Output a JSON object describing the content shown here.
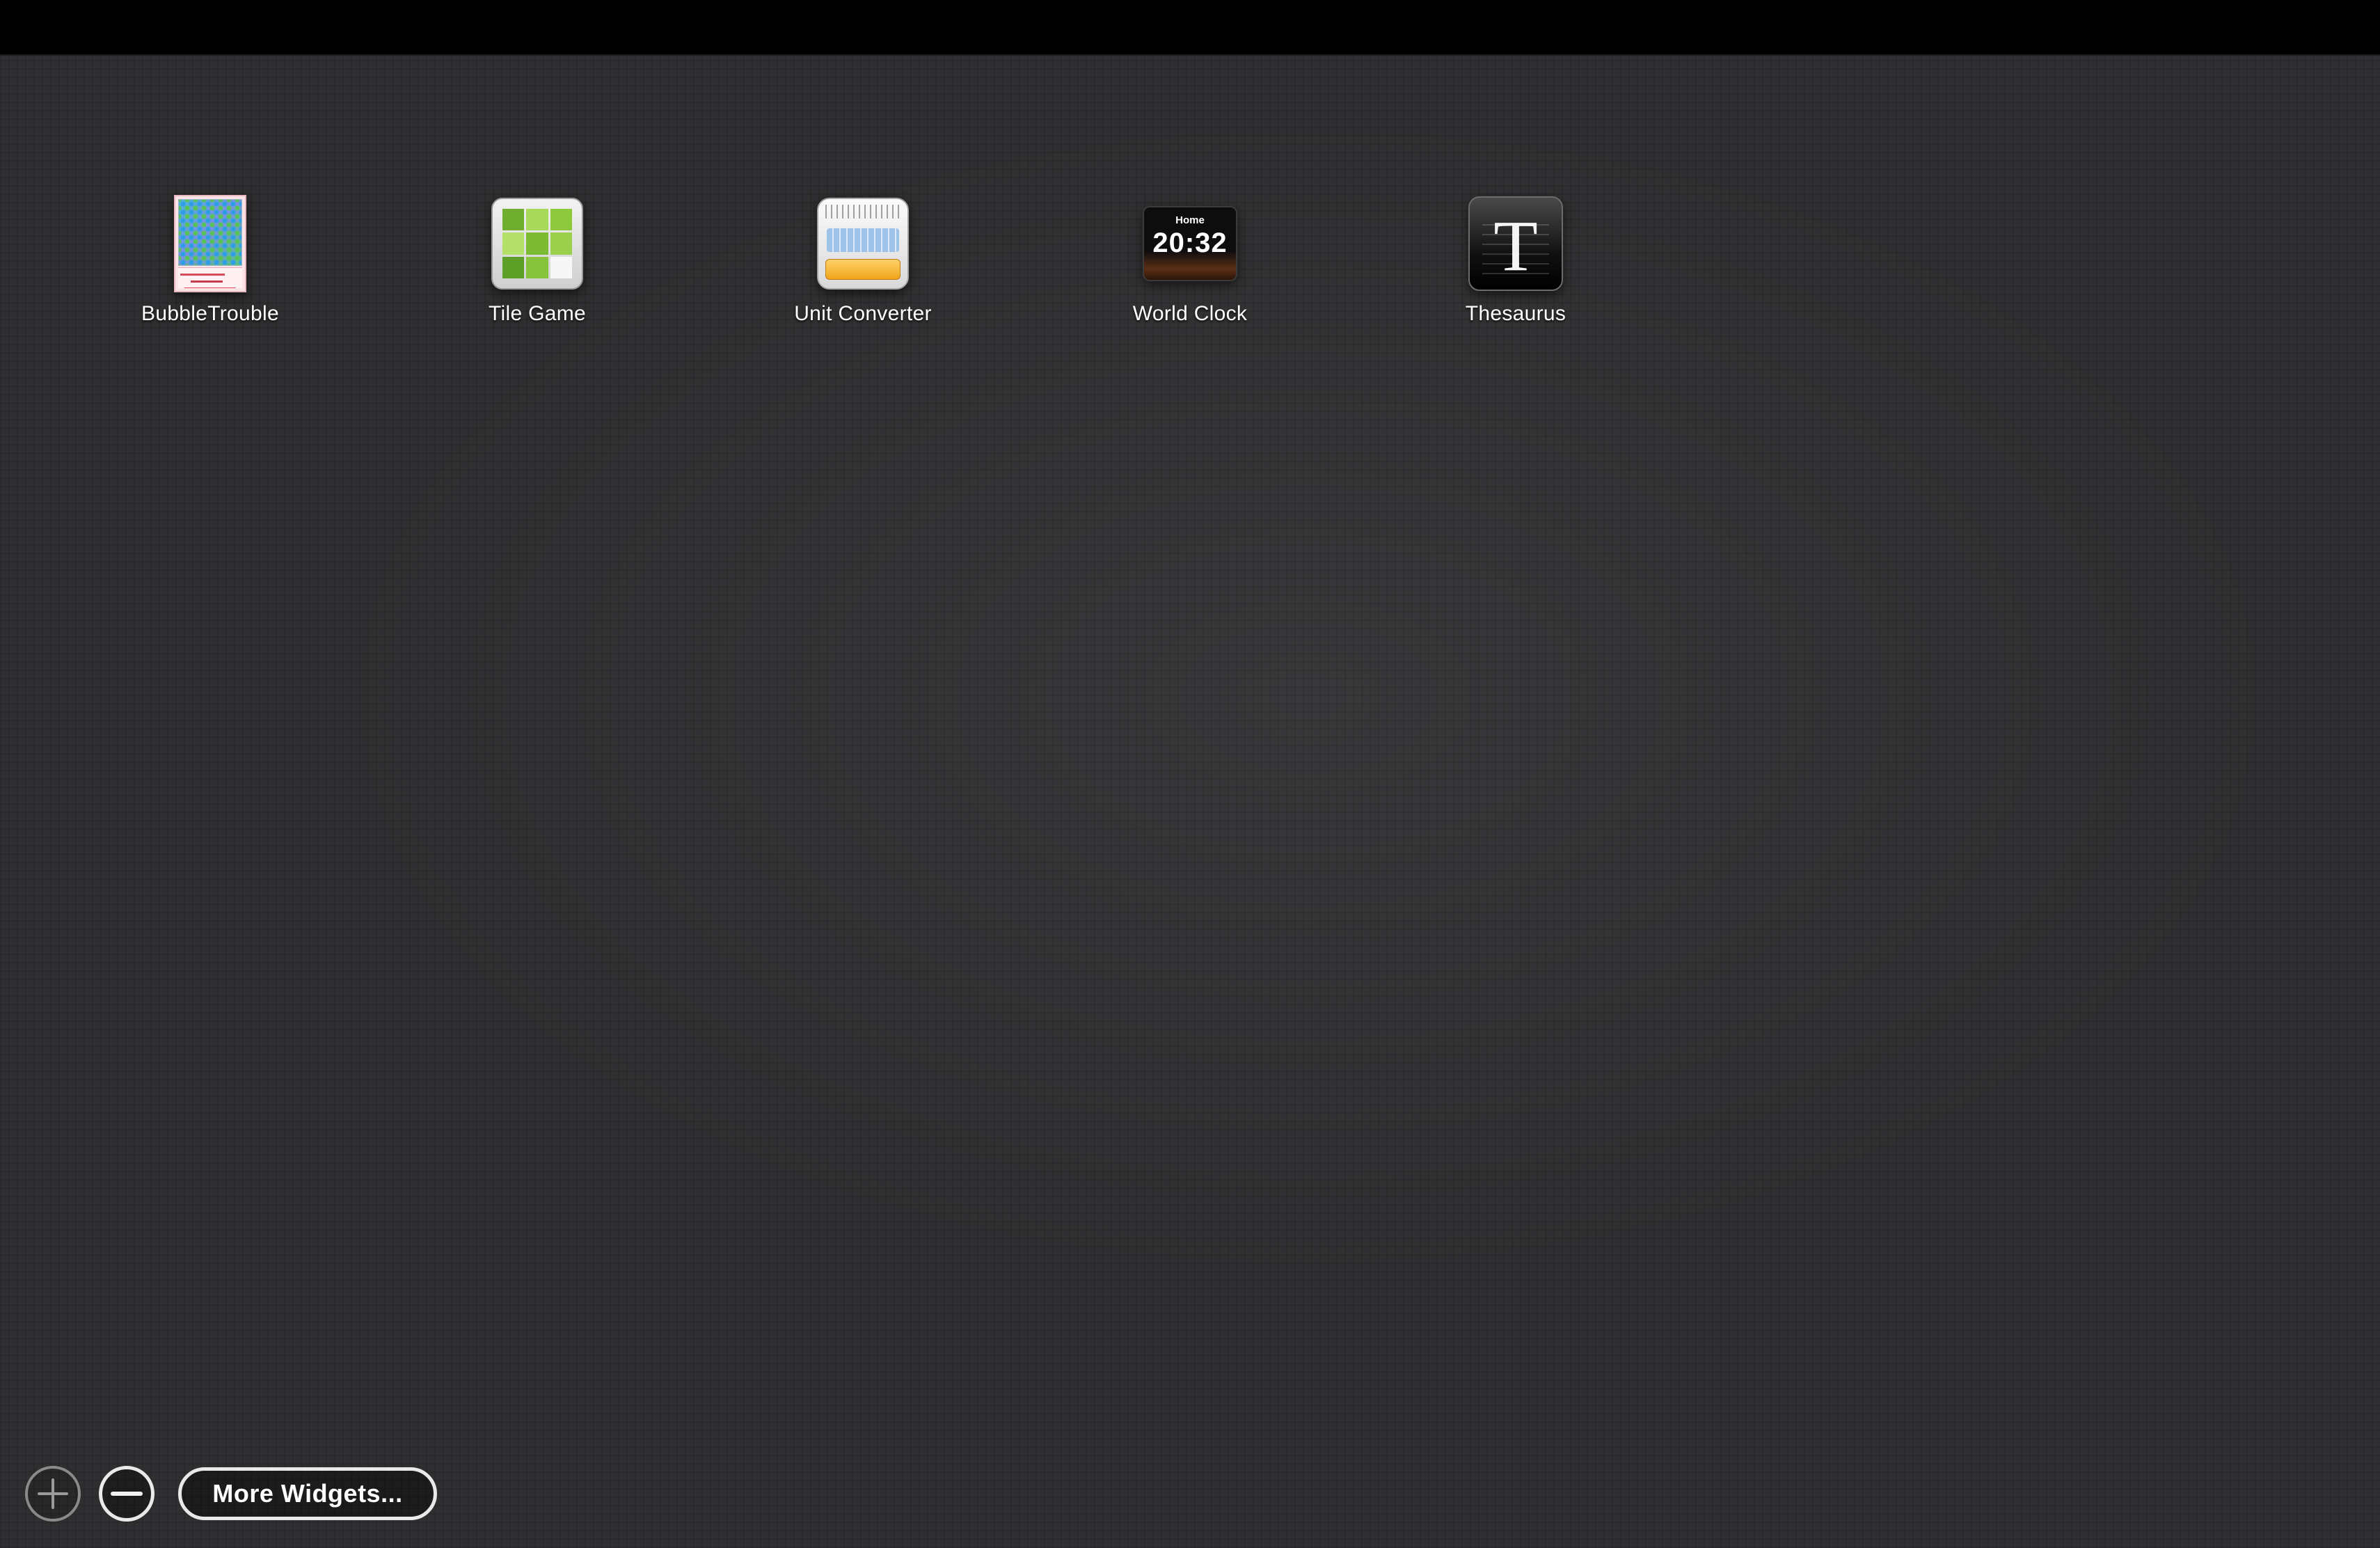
{
  "widgets": [
    {
      "label": "BubbleTrouble",
      "icon": "bubble-trouble-icon"
    },
    {
      "label": "Tile Game",
      "icon": "tile-game-icon"
    },
    {
      "label": "Unit Converter",
      "icon": "unit-converter-icon"
    },
    {
      "label": "World Clock",
      "icon": "world-clock-icon"
    },
    {
      "label": "Thesaurus",
      "icon": "thesaurus-icon"
    }
  ],
  "world_clock": {
    "city": "Home",
    "time": "20:32"
  },
  "thesaurus": {
    "letter": "T"
  },
  "controls": {
    "add_icon": "plus-icon",
    "remove_icon": "minus-icon",
    "more_widgets_label": "More Widgets..."
  },
  "colors": {
    "background": "#2f2f31",
    "topbar": "#000000",
    "tile_green": "#8dc83d",
    "converter_orange": "#f0a419"
  }
}
